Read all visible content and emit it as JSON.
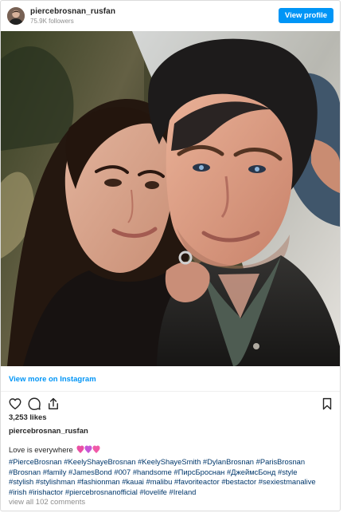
{
  "header": {
    "username": "piercebrosnan_rusfan",
    "followers": "75.9K followers",
    "view_profile_label": "View profile"
  },
  "post": {
    "view_more_label": "View more on Instagram",
    "likes": "3,253 likes",
    "caption_username": "piercebrosnan_rusfan",
    "caption_text": "Love is everywhere",
    "hashtag_lines": [
      "#PierceBrosnan #KeelyShayeBrosnan #KeelyShayeSmith #DylanBrosnan #ParisBrosnan",
      "#Brosnan #family #JamesBond #007 #handsome #ПирсБроснан #ДжеймсБонд #style",
      "#stylish #stylishman #fashionman #kauai #malibu #favoriteactor #bestactor #sexiestmanalive",
      "#irish #irishactor #piercebrosnanofficial #lovelife #Ireland"
    ],
    "comments_link": "view all 102 comments"
  },
  "icons": {
    "like": "heart-outline-icon",
    "comment": "comment-bubble-icon",
    "share": "share-upload-icon",
    "save": "bookmark-outline-icon",
    "emoji": "hearts-emoji-icon"
  },
  "colors": {
    "accent": "#0095f6",
    "hashtag": "#00376b",
    "secondary_text": "#8e8e8e",
    "border": "#dbdbdb",
    "emoji": "#ea4fa4"
  }
}
